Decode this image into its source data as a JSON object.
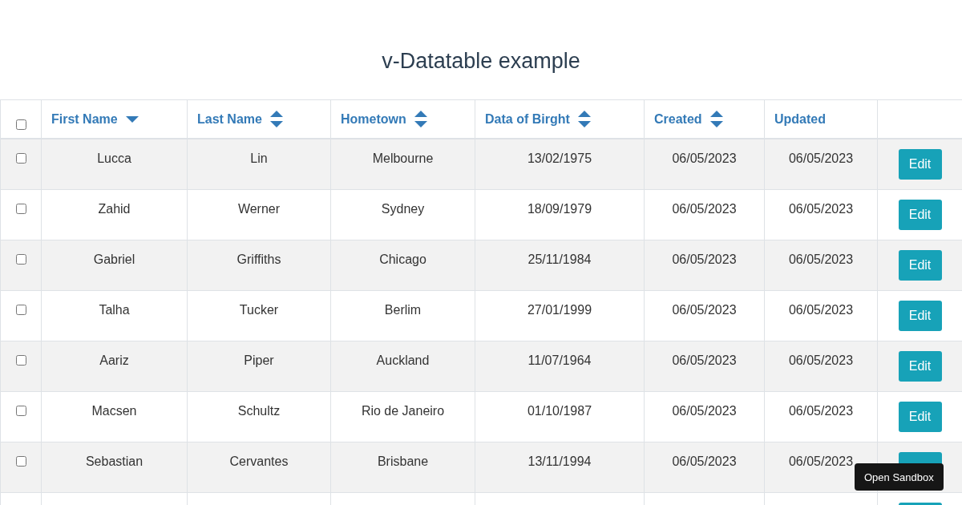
{
  "title": "v-Datatable example",
  "table": {
    "select_all": {
      "checked": false
    },
    "columns": [
      {
        "label": "First Name",
        "sortable": true,
        "sorted": true
      },
      {
        "label": "Last Name",
        "sortable": true,
        "sorted": false
      },
      {
        "label": "Hometown",
        "sortable": true,
        "sorted": false
      },
      {
        "label": "Data of Birght",
        "sortable": true,
        "sorted": false
      },
      {
        "label": "Created",
        "sortable": true,
        "sorted": false
      },
      {
        "label": "Updated",
        "sortable": false,
        "sorted": false
      }
    ],
    "rows": [
      {
        "checked": false,
        "cells": [
          "Lucca",
          "Lin",
          "Melbourne",
          "13/02/1975",
          "06/05/2023",
          "06/05/2023"
        ],
        "action": "Edit"
      },
      {
        "checked": false,
        "cells": [
          "Zahid",
          "Werner",
          "Sydney",
          "18/09/1979",
          "06/05/2023",
          "06/05/2023"
        ],
        "action": "Edit"
      },
      {
        "checked": false,
        "cells": [
          "Gabriel",
          "Griffiths",
          "Chicago",
          "25/11/1984",
          "06/05/2023",
          "06/05/2023"
        ],
        "action": "Edit"
      },
      {
        "checked": false,
        "cells": [
          "Talha",
          "Tucker",
          "Berlim",
          "27/01/1999",
          "06/05/2023",
          "06/05/2023"
        ],
        "action": "Edit"
      },
      {
        "checked": false,
        "cells": [
          "Aariz",
          "Piper",
          "Auckland",
          "11/07/1964",
          "06/05/2023",
          "06/05/2023"
        ],
        "action": "Edit"
      },
      {
        "checked": false,
        "cells": [
          "Macsen",
          "Schultz",
          "Rio de Janeiro",
          "01/10/1987",
          "06/05/2023",
          "06/05/2023"
        ],
        "action": "Edit"
      },
      {
        "checked": false,
        "cells": [
          "Sebastian",
          "Cervantes",
          "Brisbane",
          "13/11/1994",
          "06/05/2023",
          "06/05/2023"
        ]
      },
      {
        "cells": []
      }
    ]
  },
  "tooltip": "Open Sandbox"
}
